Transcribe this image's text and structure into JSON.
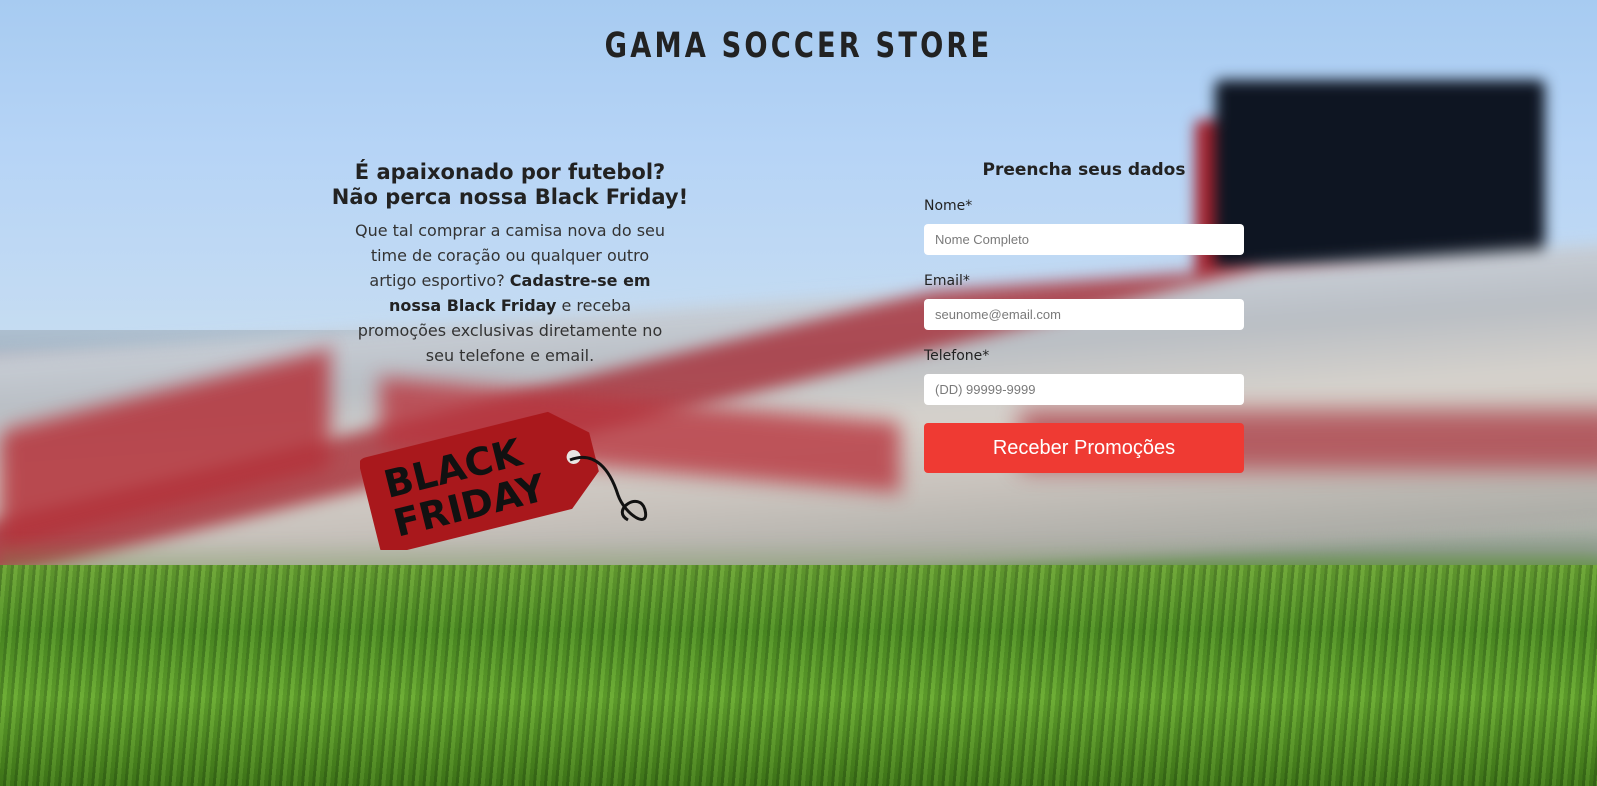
{
  "header": {
    "title": "GAMA SOCCER STORE"
  },
  "promo": {
    "heading_line1": "É apaixonado por futebol?",
    "heading_line2": "Não perca nossa Black Friday!",
    "text_part1": "Que tal comprar a camisa nova do seu time de coração ou qualquer outro artigo esportivo? ",
    "text_bold": "Cadastre-se em nossa Black Friday",
    "text_part2": " e receba promoções exclusivas diretamente no seu telefone e email.",
    "tag_line1": "BLACK",
    "tag_line2": "FRIDAY"
  },
  "form": {
    "title": "Preencha seus dados",
    "name_label": "Nome*",
    "name_placeholder": "Nome Completo",
    "email_label": "Email*",
    "email_placeholder": "seunome@email.com",
    "phone_label": "Telefone*",
    "phone_placeholder": "(DD) 99999-9999",
    "submit_label": "Receber Promoções"
  },
  "colors": {
    "accent": "#ef3a33",
    "tag_red": "#a9181c"
  }
}
